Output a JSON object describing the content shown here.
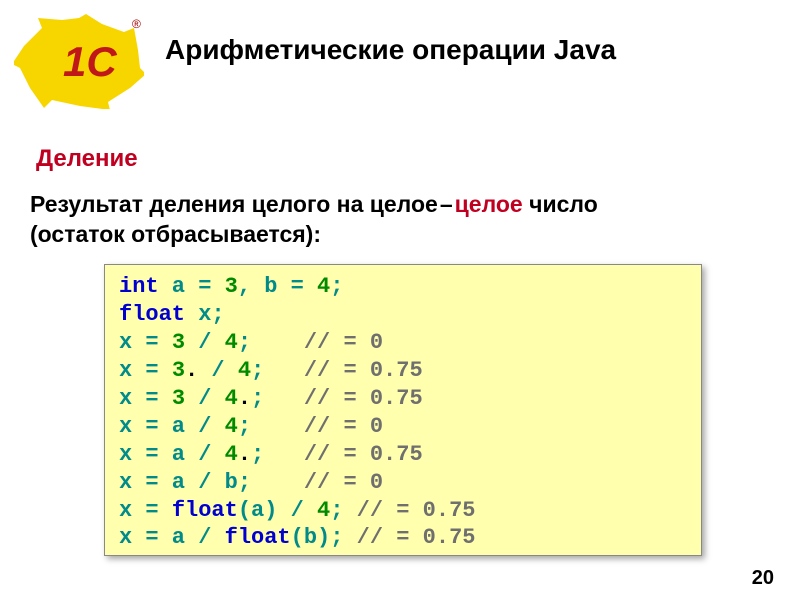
{
  "logo": {
    "name": "1C",
    "reg": "®",
    "fill": "#f7d600",
    "text": "#c01818"
  },
  "title": "Арифметические операции Java",
  "subtitle": "Деление",
  "desc": {
    "p1": "Результат деления целого на целое",
    "dash": "–",
    "p2": "целое",
    "p3": " число",
    "p4": "(остаток отбрасывается):"
  },
  "code": {
    "l1": {
      "kw": "int",
      "rest": " a = ",
      "n1": "3",
      "mid": ", b = ",
      "n2": "4",
      "end": ";"
    },
    "l2": {
      "kw": "float",
      "rest": " x;"
    },
    "l3": {
      "a": "x = ",
      "n1": "3",
      "b": " / ",
      "n2": "4",
      "c": ";    ",
      "cmt": "// = 0"
    },
    "l4": {
      "a": "x = ",
      "n1": "3",
      "dot": ".",
      "b": " / ",
      "n2": "4",
      "c": ";   ",
      "cmt": "// = 0.75"
    },
    "l5": {
      "a": "x = ",
      "n1": "3",
      "b": " / ",
      "n2": "4",
      "dot": ".",
      "c": ";   ",
      "cmt": "// = 0.75"
    },
    "l6": {
      "a": "x = a / ",
      "n2": "4",
      "c": ";    ",
      "cmt": "// = 0"
    },
    "l7": {
      "a": "x = a / ",
      "n2": "4",
      "dot": ".",
      "c": ";   ",
      "cmt": "// = 0.75"
    },
    "l8": {
      "a": "x = a / b;    ",
      "cmt": "// = 0"
    },
    "l9": {
      "a": "x = ",
      "kw": "float",
      "b": "(a) / ",
      "n2": "4",
      "c": "; ",
      "cmt": "// = 0.75"
    },
    "l10": {
      "a": "x = a / ",
      "kw": "float",
      "b": "(b); ",
      "cmt": "// = 0.75"
    }
  },
  "page_number": "20"
}
